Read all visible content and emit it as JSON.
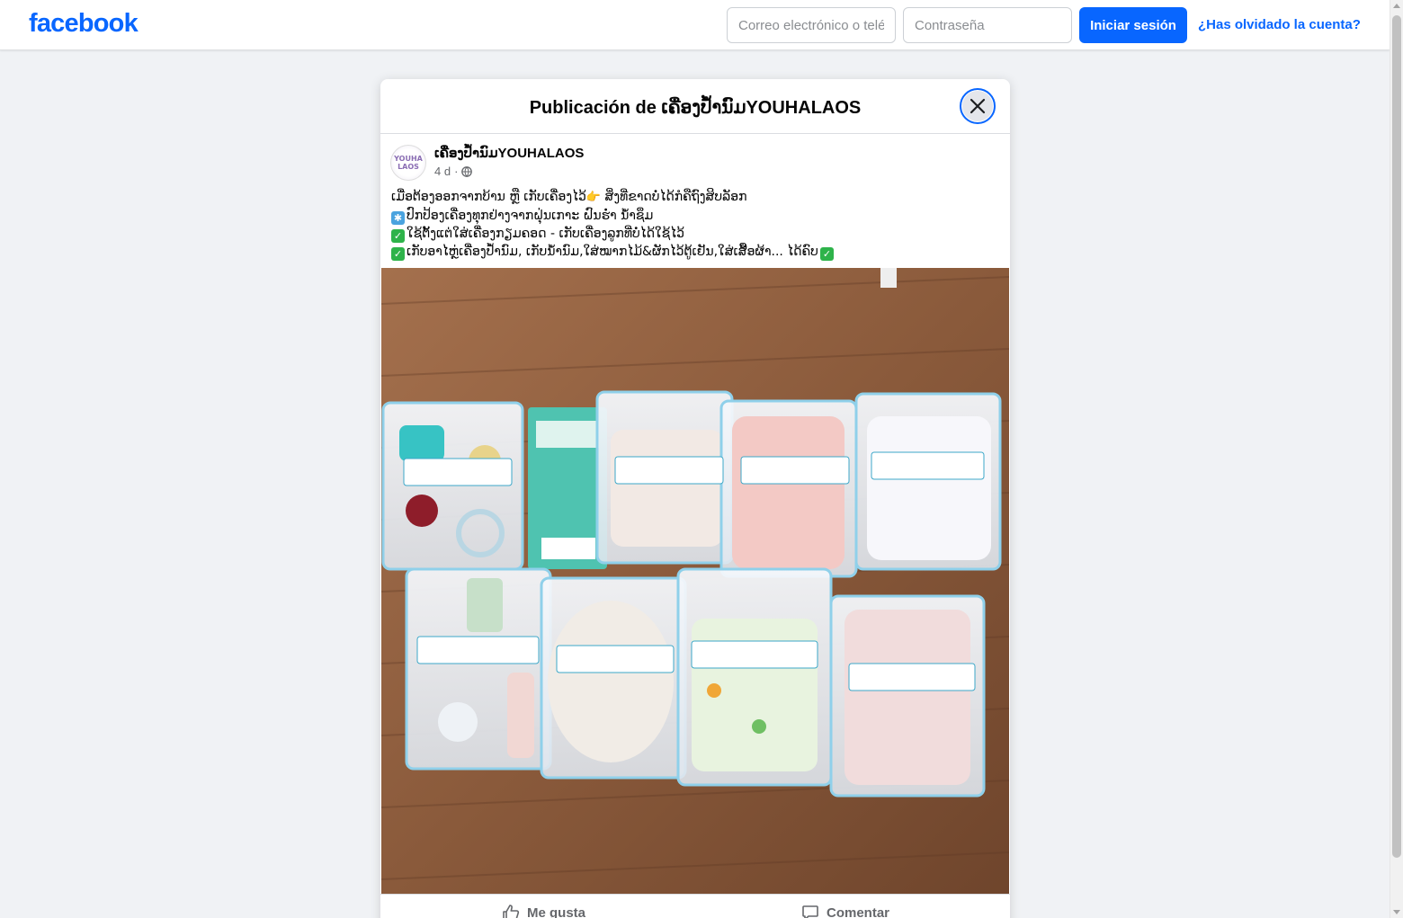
{
  "header": {
    "logo": "facebook",
    "email_placeholder": "Correo electrónico o teléfono",
    "password_placeholder": "Contraseña",
    "login_label": "Iniciar sesión",
    "forgot_label": "¿Has olvidado la cuenta?"
  },
  "modal": {
    "title": "Publicación de ເຄື່ອງປ້ຳນົມYOUHALAOS"
  },
  "post": {
    "page_name": "ເຄື່ອງປ້ຳນົມYOUHALAOS",
    "avatar_text": "YOUHA LAOS",
    "time": "4 d",
    "separator": "·",
    "audience_icon": "globe-icon",
    "lines": [
      "ເມື່ອຕ້ອງອອກຈາກບ້ານ ຫຼື ເກັບເຄື່ອງໄວ້",
      "ປົກປ້ອງເຄື່ອງທຸກຢ່າງຈາກຝຸ່ນເກາະ ຝົນຮ່ຳ ນ້ຳຊຶມ",
      "ໃຊ້ຕັ້ງແຕ່ໃສ່ເຄື່ອງກຽມຄອດ - ເກັບເຄື່ອງລູກທີ່ບໍ່ໄດ້ໃຊ້ໄວ້",
      "ເກັບອາໄຫຼ່ເຄື່ອງປ້ຳນົມ, ເກັບນ້ຳນົມ,ໃສ່ໝາກໄມ້&ຜັກໄວ້ຕູ້ເຢັນ,ໃສ່ເສື້ອຜ້າ... ໄດ້ຄົບ"
    ],
    "line1_tail": " ສິ່ງທີ່ຂາດບໍ່ໄດ້ກໍຄືຖົງສິບລັອກ"
  },
  "actions": {
    "like_label": "Me gusta",
    "comment_label": "Comentar"
  },
  "colors": {
    "brand": "#0866ff",
    "background": "#f0f2f5"
  }
}
